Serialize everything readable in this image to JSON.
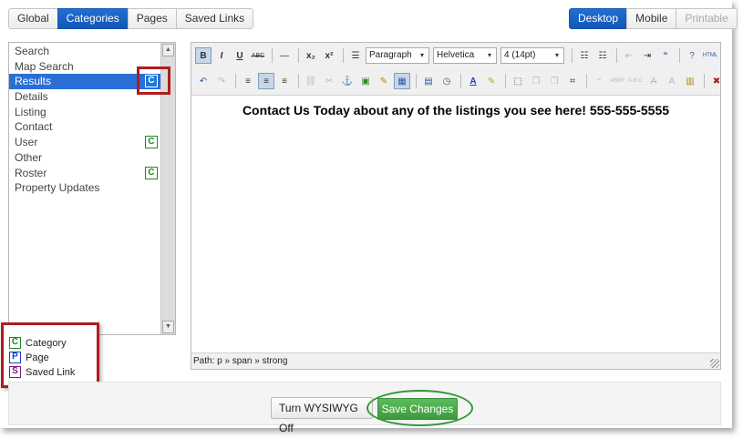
{
  "top_tabs": [
    {
      "label": "Global",
      "active": false
    },
    {
      "label": "Categories",
      "active": true
    },
    {
      "label": "Pages",
      "active": false
    },
    {
      "label": "Saved Links",
      "active": false
    }
  ],
  "view_tabs": [
    {
      "label": "Desktop",
      "active": true
    },
    {
      "label": "Mobile",
      "active": false
    },
    {
      "label": "Printable",
      "active": false,
      "disabled": true
    }
  ],
  "list": {
    "items": [
      {
        "label": "Search",
        "badge": ""
      },
      {
        "label": "Map Search",
        "badge": ""
      },
      {
        "label": "Results",
        "badge": "C",
        "selected": true
      },
      {
        "label": "Details",
        "badge": ""
      },
      {
        "label": "Listing",
        "badge": ""
      },
      {
        "label": "Contact",
        "badge": ""
      },
      {
        "label": "User",
        "badge": "C"
      },
      {
        "label": "Other",
        "badge": ""
      },
      {
        "label": "Roster",
        "badge": "C"
      },
      {
        "label": "Property Updates",
        "badge": ""
      }
    ]
  },
  "legend": [
    {
      "key": "C",
      "label": "Category",
      "color": "#1d8a1d"
    },
    {
      "key": "P",
      "label": "Page",
      "color": "#1a3fc4"
    },
    {
      "key": "S",
      "label": "Saved Link",
      "color": "#7a1a7a"
    }
  ],
  "toolbar": {
    "format_select": "Paragraph",
    "font_select": "Helvetica",
    "size_select": "4 (14pt)"
  },
  "editor": {
    "content": "Contact Us Today about any of the listings you see here! 555-555-5555",
    "path": "Path: p » span » strong"
  },
  "footer": {
    "wysiwyg_label": "Turn WYSIWYG Off",
    "save_label": "Save Changes"
  },
  "colors": {
    "accent_blue": "#1f6fd1",
    "highlight_red": "#b01c1c",
    "save_green": "#3c9a3c"
  }
}
